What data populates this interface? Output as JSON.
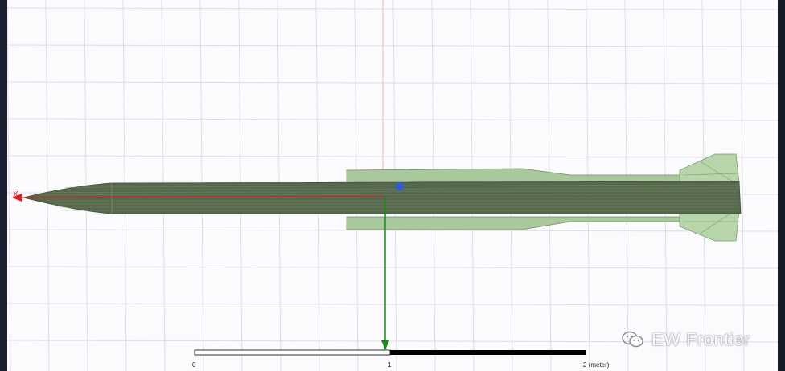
{
  "viewport": {
    "axis_label_x": "X"
  },
  "scale_bar": {
    "tick_0": "0",
    "tick_1": "1",
    "tick_2": "2 (meter)"
  },
  "watermark": {
    "text": "EW Frontier",
    "icon": "wechat-icon"
  },
  "colors": {
    "background": "#fbfbfd",
    "grid": "#d9d9e2",
    "missile_body": "#566b4c",
    "missile_fins": "#a8c79c",
    "axis_x": "#e02020",
    "axis_y": "#1a8a1a",
    "origin_marker": "#2f5bd8"
  }
}
